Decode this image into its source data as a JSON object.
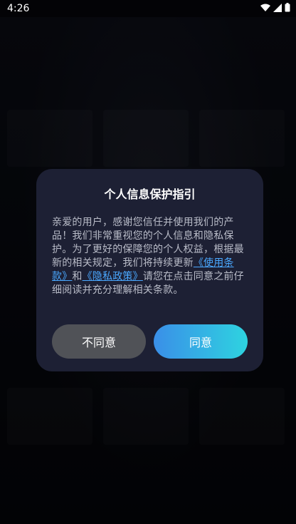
{
  "status_bar": {
    "time": "4:26",
    "icons": [
      "wifi-icon",
      "signal-icon",
      "battery-icon"
    ]
  },
  "dialog": {
    "title": "个人信息保护指引",
    "body_part1": "亲爱的用户，感谢您信任并使用我们的产品！我们非常重视您的个人信息和隐私保护。为了更好的保障您的个人权益，根据最新的相关规定，我们将持续更新",
    "terms_link": "《使用条款》",
    "and_text": "和",
    "privacy_link": "《隐私政策》",
    "body_part2": "请您在点击同意之前仔细阅读并充分理解相关条款。",
    "decline_label": "不同意",
    "agree_label": "同意"
  },
  "colors": {
    "dialog_bg": "#1d2034",
    "link": "#4aa8ff",
    "decline_btn": "#505257",
    "agree_gradient_start": "#3a8fe8",
    "agree_gradient_end": "#2ed3e0"
  }
}
